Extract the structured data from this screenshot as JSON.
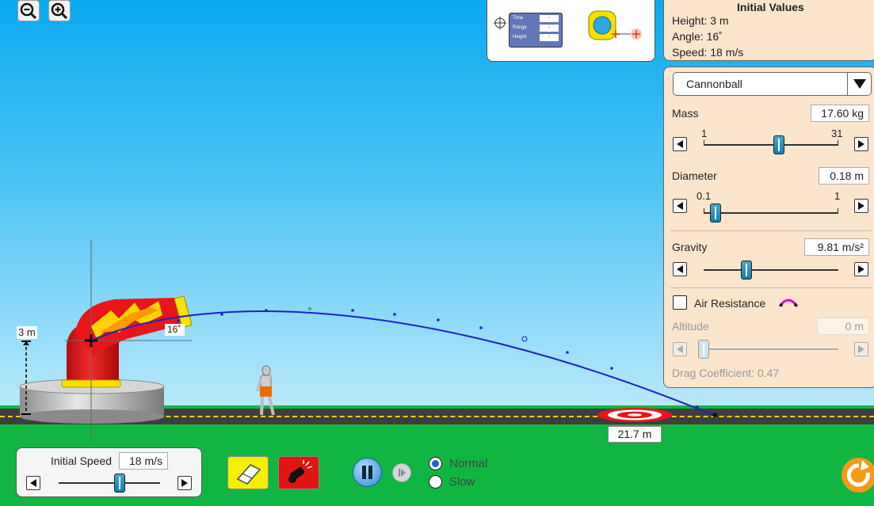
{
  "initial_values": {
    "title": "Initial Values",
    "height": "Height: 3 m",
    "angle": "Angle: 16˚",
    "speed": "Speed: 18 m/s"
  },
  "tools": {
    "readout_labels": [
      "Time",
      "Range",
      "Height"
    ],
    "readout_values": [
      "-",
      "-",
      "-"
    ]
  },
  "projectile": {
    "selected": "Cannonball"
  },
  "mass": {
    "label": "Mass",
    "value": "17.60 kg",
    "min_label": "1",
    "max_label": "31",
    "fraction": 0.56
  },
  "diameter": {
    "label": "Diameter",
    "value": "0.18 m",
    "min_label": "0.1",
    "max_label": "1",
    "fraction": 0.09
  },
  "gravity": {
    "label": "Gravity",
    "value": "9.81 m/s²",
    "fraction": 0.32
  },
  "air_resistance": {
    "label": "Air Resistance",
    "checked": false
  },
  "altitude": {
    "label": "Altitude",
    "value": "0 m",
    "fraction": 0.0
  },
  "drag": {
    "text": "Drag Coefficient: 0.47"
  },
  "scene": {
    "height_label": "3 m",
    "angle_label": "16˚",
    "range_label": "21.7 m"
  },
  "initial_speed": {
    "label": "Initial Speed",
    "value": "18 m/s",
    "fraction": 0.6
  },
  "playback": {
    "normal_label": "Normal",
    "slow_label": "Slow",
    "selected": "Normal"
  },
  "colors": {
    "sky_top": "#0aaaf0",
    "grass": "#11b542",
    "road": "#3e3e3e",
    "trajectory": "#2020c8",
    "panel": "#fbe5cc",
    "cannon_red": "#d81e1e",
    "reset": "#f39a19"
  }
}
